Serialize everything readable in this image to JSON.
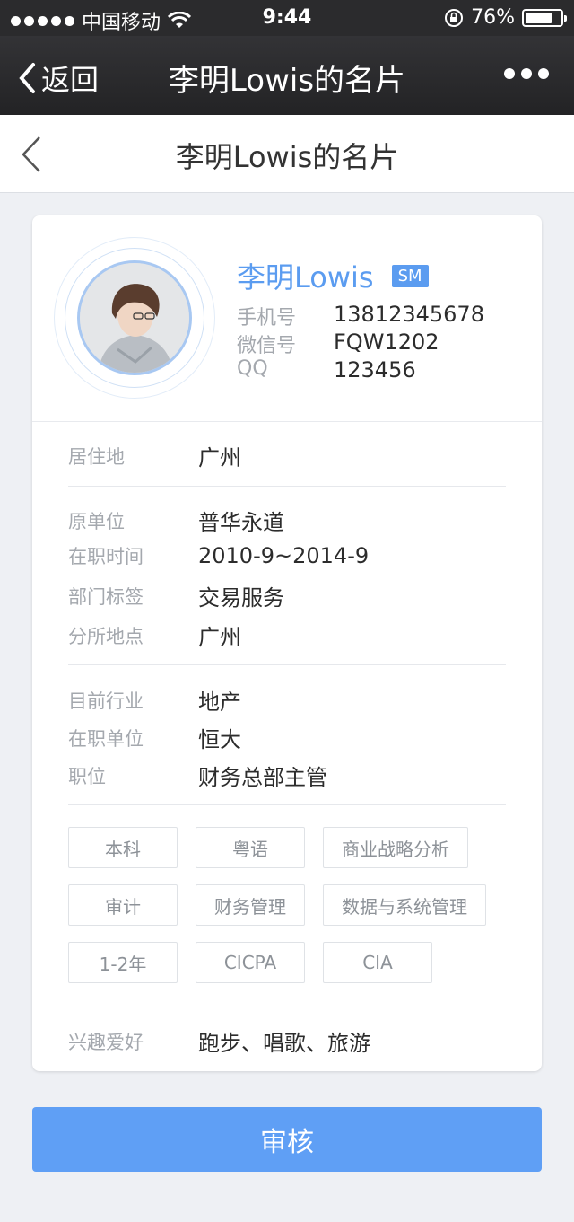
{
  "status_bar": {
    "carrier": "中国移动",
    "time": "9:44",
    "battery": "76%",
    "battery_level": 0.76
  },
  "nav": {
    "back_label": "返回",
    "title": "李明Lowis的名片"
  },
  "sub_header": {
    "title": "李明Lowis的名片"
  },
  "profile": {
    "name": "李明Lowis",
    "badge": "SM",
    "contacts": [
      {
        "label": "手机号",
        "value": "13812345678"
      },
      {
        "label": "微信号",
        "value": "FQW1202"
      },
      {
        "label": "QQ",
        "value": "123456"
      }
    ]
  },
  "residence": {
    "label": "居住地",
    "value": "广州"
  },
  "previous_job": [
    {
      "label": "原单位",
      "value": "普华永道"
    },
    {
      "label": "在职时间",
      "value": "2010-9~2014-9"
    },
    {
      "label": "部门标签",
      "value": "交易服务"
    },
    {
      "label": "分所地点",
      "value": "广州"
    }
  ],
  "current_job": [
    {
      "label": "目前行业",
      "value": "地产"
    },
    {
      "label": "在职单位",
      "value": "恒大"
    },
    {
      "label": "职位",
      "value": "财务总部主管"
    }
  ],
  "tags": [
    "本科",
    "粤语",
    "商业战略分析",
    "审计",
    "财务管理",
    "数据与系统管理",
    "1-2年",
    "CICPA",
    "CIA"
  ],
  "hobbies": {
    "label": "兴趣爱好",
    "value": "跑步、唱歌、旅游"
  },
  "submit_label": "审核",
  "colors": {
    "accent": "#5b9cf0",
    "button": "#5f9ff5",
    "navbar": "#2b2b2d"
  }
}
